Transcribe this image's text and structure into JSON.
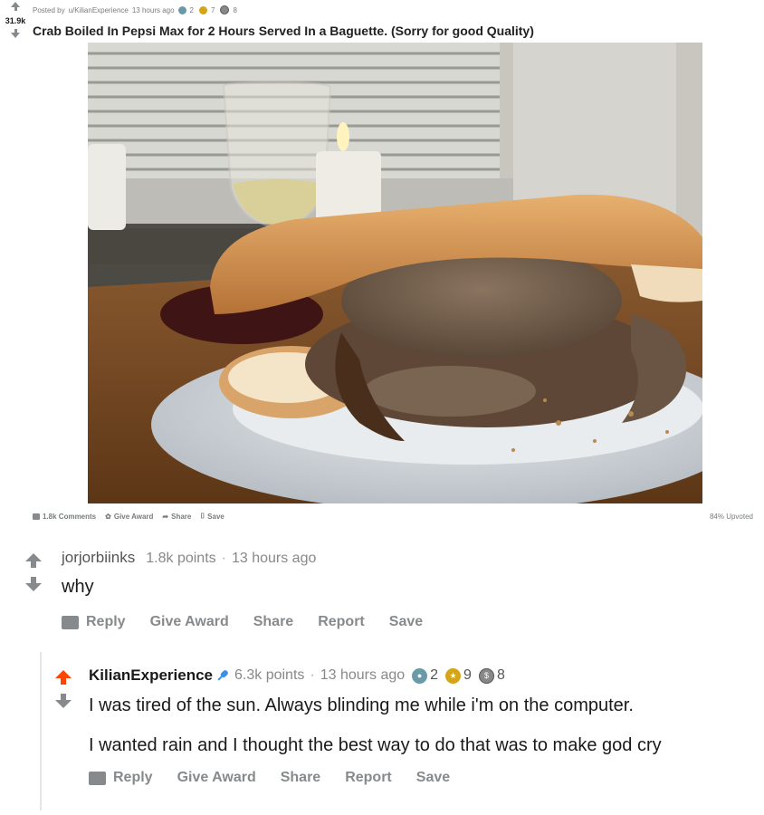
{
  "post": {
    "score": "31.9k",
    "meta_prefix": "Posted by",
    "author": "u/KilianExperience",
    "time": "13 hours ago",
    "awards": [
      {
        "type": "silver",
        "count": "2"
      },
      {
        "type": "gold",
        "count": "7"
      },
      {
        "type": "platinum",
        "count": "8"
      }
    ],
    "title": "Crab Boiled In Pepsi Max for 2 Hours Served In a Baguette. (Sorry for good Quality)",
    "actions": {
      "comments": "1.8k Comments",
      "give_award": "Give Award",
      "share": "Share",
      "save": "Save"
    },
    "upvoted": "84% Upvoted"
  },
  "comments": [
    {
      "author": "jorjorbiinks",
      "points": "1.8k points",
      "separator": "·",
      "time": "13 hours ago",
      "body": [
        "why"
      ],
      "actions": {
        "reply": "Reply",
        "give_award": "Give Award",
        "share": "Share",
        "report": "Report",
        "save": "Save"
      }
    },
    {
      "author": "KilianExperience",
      "points": "6.3k points",
      "separator": "·",
      "time": "13 hours ago",
      "awards": [
        {
          "type": "silver",
          "count": "2"
        },
        {
          "type": "gold",
          "count": "9"
        },
        {
          "type": "platinum",
          "count": "8"
        }
      ],
      "body": [
        "I was tired of the sun. Always blinding me while i'm on the computer.",
        "I wanted rain and I thought the best way to do that was to make god cry"
      ],
      "actions": {
        "reply": "Reply",
        "give_award": "Give Award",
        "share": "Share",
        "report": "Report",
        "save": "Save"
      }
    }
  ],
  "colors": {
    "upvote_active": "#ff4500",
    "mic_blue": "#3d8ee6",
    "muted": "#878a8c"
  }
}
